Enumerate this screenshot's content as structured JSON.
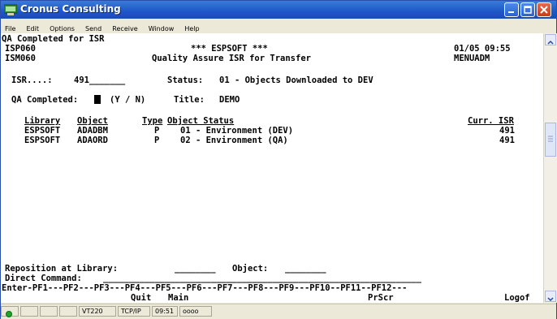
{
  "window": {
    "title": "Cronus Consulting"
  },
  "menu": [
    "File",
    "Edit",
    "Options",
    "Send",
    "Receive",
    "Window",
    "Help"
  ],
  "screen": {
    "header": "QA Completed for ISR",
    "program_id": "ISP060",
    "program_id2": "ISM060",
    "system": "*** ESPSOFT ***",
    "subtitle": "Quality Assure ISR for Transfer",
    "datetime": "01/05 09:55",
    "menu_id": "MENUADM",
    "isr_label": "ISR....:",
    "isr_value": "491",
    "status_label": "Status:",
    "status_value": "01 - Objects Downloaded to DEV",
    "qa_label": "QA Completed:",
    "qa_value": "",
    "qa_hint": "(Y / N)",
    "title_label": "Title:",
    "title_value": "DEMO",
    "columns": [
      "Library",
      "Object",
      "Type",
      "Object Status",
      "Curr. ISR"
    ],
    "rows": [
      [
        "ESPSOFT",
        "ADADBM",
        "P",
        "01 - Environment (DEV)",
        "491"
      ],
      [
        "ESPSOFT",
        "ADAORD",
        "P",
        "02 - Environment (QA)",
        "491"
      ]
    ],
    "reposition_label": "Reposition at Library:",
    "object_label": "Object:",
    "direct_command_label": "Direct Command:",
    "fkeys_line": "Enter-PF1---PF2---PF3---PF4---PF5---PF6---PF7---PF8---PF9---PF10--PF11--PF12---",
    "fkeys_labels": {
      "pf3": "Quit",
      "pf4": "Main",
      "pf9": "PrScr",
      "pf12": "Logof"
    }
  },
  "status_bar": {
    "terminal": "VT220",
    "protocol": "TCP/IP",
    "time": "09:51",
    "indicator": "oooo"
  }
}
